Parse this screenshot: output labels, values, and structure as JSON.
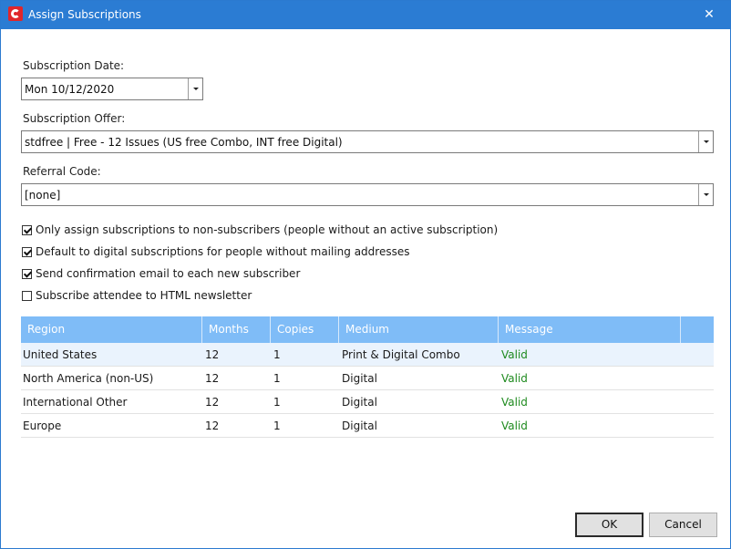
{
  "window": {
    "title": "Assign Subscriptions",
    "close_glyph": "✕",
    "accent": "#2b7cd3"
  },
  "form": {
    "date_label": "Subscription Date:",
    "date_value": "Mon 10/12/2020",
    "offer_label": "Subscription Offer:",
    "offer_value": "stdfree | Free - 12 Issues (US free Combo, INT free Digital)",
    "referral_label": "Referral Code:",
    "referral_value": "[none]"
  },
  "options": [
    {
      "label": "Only assign subscriptions to non-subscribers (people without an active subscription)",
      "checked": true
    },
    {
      "label": "Default to digital subscriptions for people without mailing addresses",
      "checked": true
    },
    {
      "label": "Send confirmation email to each new subscriber",
      "checked": true
    },
    {
      "label": "Subscribe attendee to HTML newsletter",
      "checked": false
    }
  ],
  "table": {
    "columns": [
      "Region",
      "Months",
      "Copies",
      "Medium",
      "Message"
    ],
    "rows": [
      [
        "United States",
        "12",
        "1",
        "Print & Digital Combo",
        "Valid"
      ],
      [
        "North America (non-US)",
        "12",
        "1",
        "Digital",
        "Valid"
      ],
      [
        "International Other",
        "12",
        "1",
        "Digital",
        "Valid"
      ],
      [
        "Europe",
        "12",
        "1",
        "Digital",
        "Valid"
      ]
    ]
  },
  "buttons": {
    "ok": "OK",
    "cancel": "Cancel"
  }
}
